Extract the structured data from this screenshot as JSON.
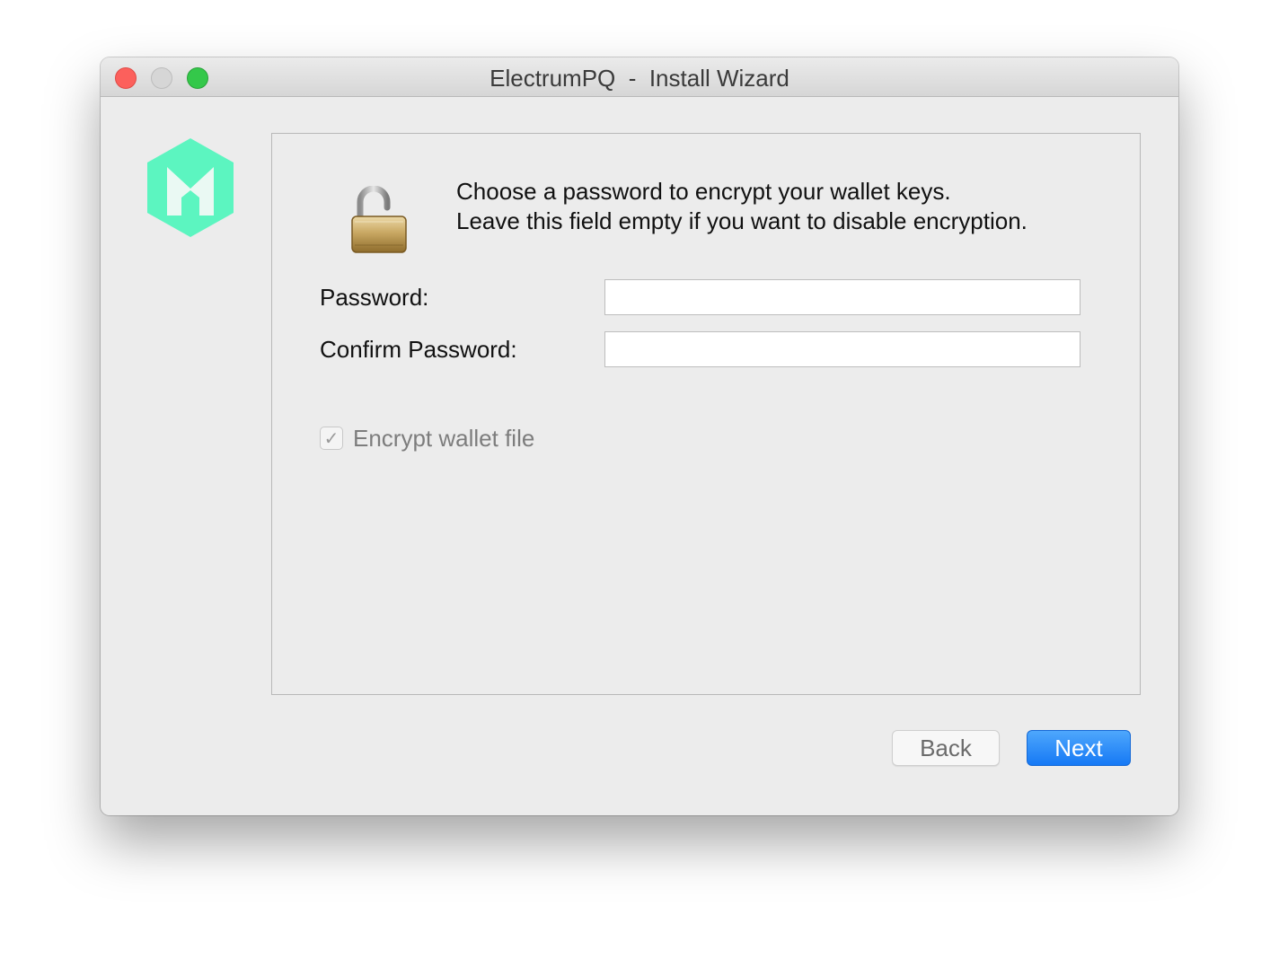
{
  "window": {
    "title": "ElectrumPQ  -  Install Wizard"
  },
  "logo": {
    "icon": "electrumpq-hexagon-logo",
    "color": "#5cf5c0"
  },
  "page": {
    "icon": "unlocked-padlock-icon",
    "message_line1": "Choose a password to encrypt your wallet keys.",
    "message_line2": "Leave this field empty if you want to disable encryption.",
    "password_label": "Password:",
    "password_value": "",
    "confirm_label": "Confirm Password:",
    "confirm_value": "",
    "encrypt_checkbox": {
      "label": "Encrypt wallet file",
      "checked": true,
      "enabled": false
    }
  },
  "buttons": {
    "back": "Back",
    "next": "Next"
  },
  "colors": {
    "accent": "#1a7cf6",
    "close": "#fc605c",
    "zoom": "#34c84a"
  }
}
